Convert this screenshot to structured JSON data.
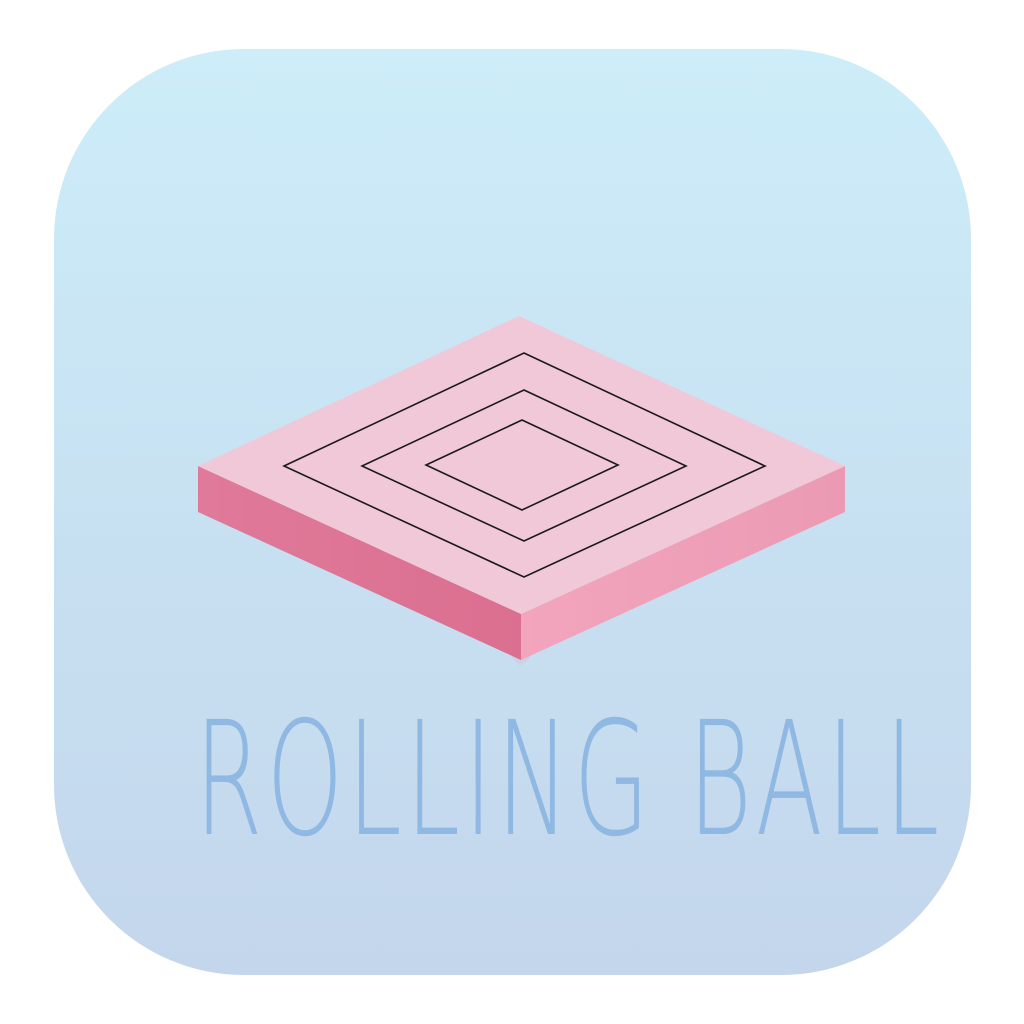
{
  "app": {
    "title": "ROLLING BALL"
  },
  "colors": {
    "background_top": "#cdedf9",
    "background_bottom": "#c4d6ec",
    "tile_top": "#f1c8d8",
    "tile_left_side": "#df7596",
    "tile_right_side": "#ef9db6",
    "maze_lines": "#1a1a1a",
    "title_text": "#8fb8e2"
  },
  "icons": {
    "tile": "isometric-maze-tile-icon"
  }
}
